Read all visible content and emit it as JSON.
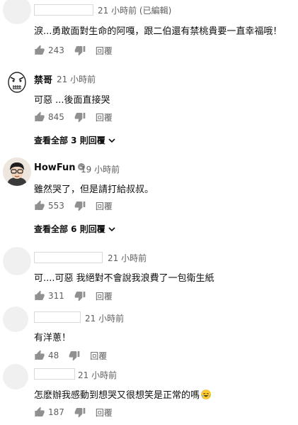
{
  "comments": [
    {
      "author": "",
      "time": "21 小時前 (已編輯)",
      "text": "淚...勇敢面對生命的阿嘎，跟二伯還有禁桃貴要一直幸福哦！",
      "likes": "243",
      "reply_label": "回覆"
    },
    {
      "author": "禁哥",
      "time": "21 小時前",
      "text": "可惡 ...後面直接哭",
      "likes": "845",
      "reply_label": "回覆",
      "view_replies": "查看全部 3 則回覆"
    },
    {
      "author": "HowFun",
      "time": "19 小時前",
      "text": "雖然哭了，但是請打給叔叔。",
      "likes": "553",
      "reply_label": "回覆",
      "view_replies": "查看全部 6 則回覆"
    },
    {
      "author": "",
      "time": "21 小時前",
      "text": "可....可惡 我絕對不會說我浪費了一包衛生紙",
      "likes": "311",
      "reply_label": "回覆"
    },
    {
      "author": "",
      "time": "21 小時前",
      "text": "有洋蔥！",
      "likes": "48",
      "reply_label": "回覆"
    },
    {
      "author": "",
      "time": "21 小時前",
      "text": "怎麽辦我感動到想哭又很想笑是正常的嗎",
      "likes": "187",
      "reply_label": "回覆"
    }
  ],
  "icons": {
    "like": "thumbs-up-icon",
    "dislike": "thumbs-down-icon",
    "expand": "chevron-down-icon",
    "verified": "verified-check-icon",
    "emoji": "laughing-emoji-icon"
  },
  "colors": {
    "text": "#0f0f0f",
    "secondary": "#606060",
    "avatar_placeholder": "#f0f0f0"
  }
}
